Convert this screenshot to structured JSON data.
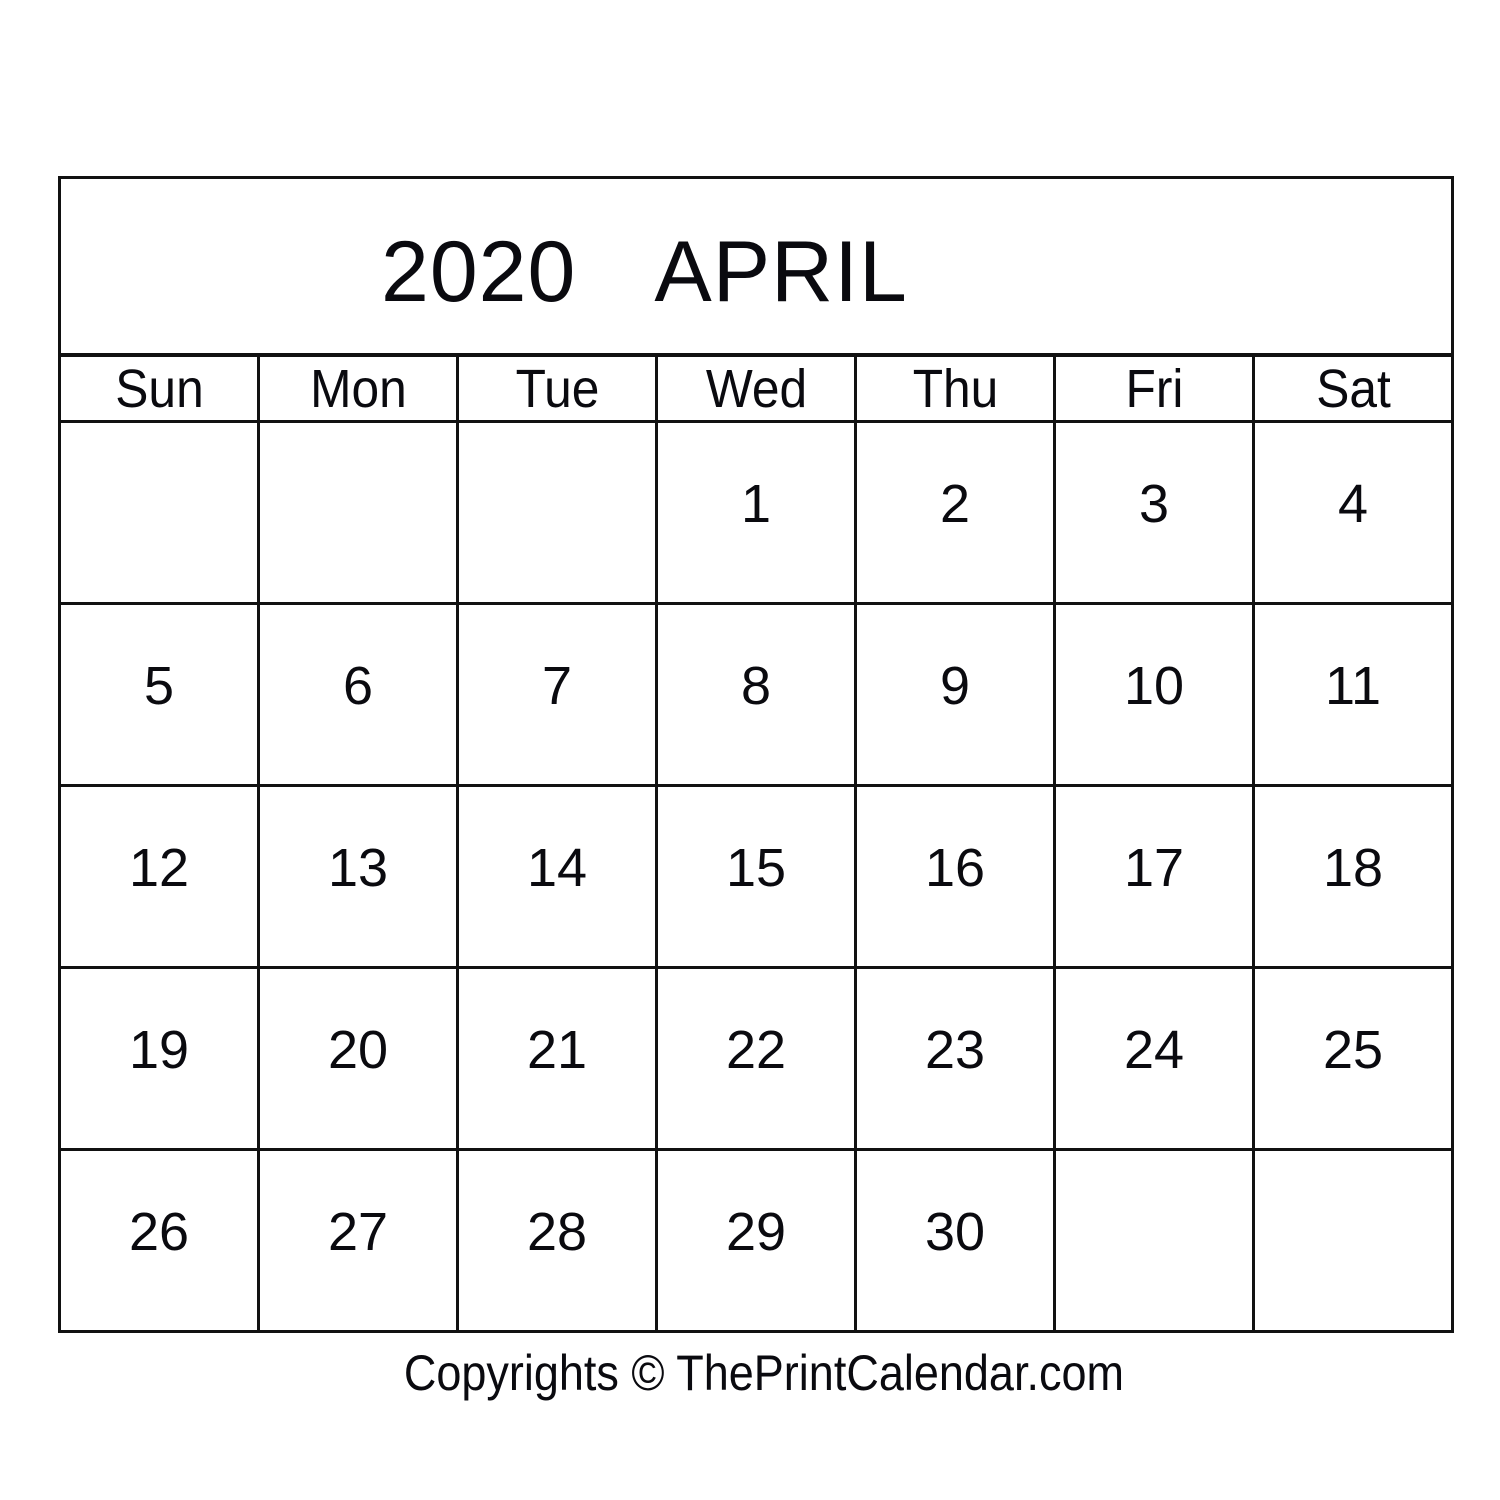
{
  "header": {
    "year": "2020",
    "month": "APRIL"
  },
  "weekdays": [
    "Sun",
    "Mon",
    "Tue",
    "Wed",
    "Thu",
    "Fri",
    "Sat"
  ],
  "weeks": [
    [
      "",
      "",
      "",
      "1",
      "2",
      "3",
      "4"
    ],
    [
      "5",
      "6",
      "7",
      "8",
      "9",
      "10",
      "11"
    ],
    [
      "12",
      "13",
      "14",
      "15",
      "16",
      "17",
      "18"
    ],
    [
      "19",
      "20",
      "21",
      "22",
      "23",
      "24",
      "25"
    ],
    [
      "26",
      "27",
      "28",
      "29",
      "30",
      "",
      ""
    ]
  ],
  "footer": {
    "copyright": "Copyrights © ThePrintCalendar.com"
  }
}
